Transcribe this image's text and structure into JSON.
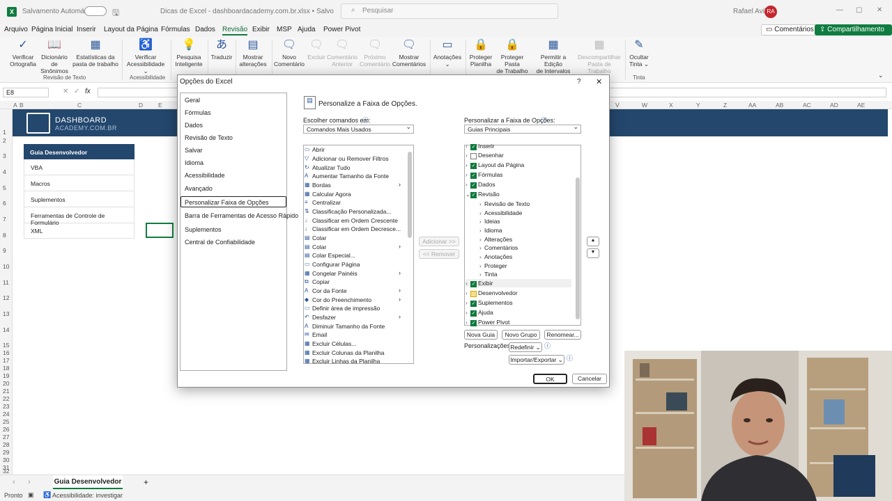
{
  "titlebar": {
    "autosave": "Salvamento Automático",
    "file_title": "Dicas de Excel - dashboardacademy.com.br.xlsx • Salvo",
    "search_placeholder": "Pesquisar",
    "user_name": "Rafael Avila",
    "user_initials": "RA"
  },
  "menu": {
    "tabs": [
      "Arquivo",
      "Página Inicial",
      "Inserir",
      "Layout da Página",
      "Fórmulas",
      "Dados",
      "Revisão",
      "Exibir",
      "MSP",
      "Ajuda",
      "Power Pivot"
    ],
    "active": "Revisão",
    "comments_btn": "Comentários",
    "share_btn": "Compartilhamento"
  },
  "ribbon": {
    "buttons": [
      {
        "l1": "Verificar",
        "l2": "Ortografia"
      },
      {
        "l1": "Dicionário de",
        "l2": "Sinônimos"
      },
      {
        "l1": "Estatísticas da",
        "l2": "pasta de trabalho"
      },
      {
        "l1": "Verificar",
        "l2": "Acessibilidade ⌄"
      },
      {
        "l1": "Pesquisa",
        "l2": "Inteligente"
      },
      {
        "l1": "Traduzir",
        "l2": ""
      },
      {
        "l1": "Mostrar",
        "l2": "alterações"
      },
      {
        "l1": "Novo",
        "l2": "Comentário"
      },
      {
        "l1": "Excluir",
        "l2": ""
      },
      {
        "l1": "Comentário",
        "l2": "Anterior"
      },
      {
        "l1": "Próximo",
        "l2": "Comentário"
      },
      {
        "l1": "Mostrar",
        "l2": "Comentários"
      },
      {
        "l1": "Anotações",
        "l2": "⌄"
      },
      {
        "l1": "Proteger",
        "l2": "Planilha"
      },
      {
        "l1": "Proteger Pasta",
        "l2": "de Trabalho"
      },
      {
        "l1": "Permitir a Edição",
        "l2": "de Intervalos"
      },
      {
        "l1": "Descompartilhar",
        "l2": "Pasta de Trabalho"
      },
      {
        "l1": "Ocultar",
        "l2": "Tinta ⌄"
      }
    ],
    "groups": [
      "Revisão de Texto",
      "Acessibilidade",
      "Tinta"
    ]
  },
  "formula": {
    "cell_ref": "E8",
    "fx": "fx"
  },
  "grid": {
    "columns": [
      "A",
      "B",
      "C",
      "D",
      "E",
      "V",
      "W",
      "X",
      "Y",
      "Z",
      "AA",
      "AB",
      "AC",
      "AD",
      "AE"
    ],
    "rows": [
      "1",
      "2",
      "3",
      "4",
      "5",
      "6",
      "7",
      "8",
      "9",
      "10",
      "11",
      "12",
      "13",
      "14",
      "15",
      "16",
      "17",
      "18",
      "19",
      "20",
      "21",
      "22",
      "23",
      "24",
      "25",
      "26",
      "27",
      "28",
      "29",
      "30",
      "31",
      "32"
    ],
    "brand_line1": "DASHBOARD",
    "brand_line2": "ACADEMY.COM.BR",
    "guide_title": "Guia Desenvolvedor",
    "guide_items": [
      "VBA",
      "Macros",
      "Suplementos",
      "Ferramentas de Controle de Formulário",
      "XML"
    ]
  },
  "sheet": {
    "tab": "Guia Desenvolvedor",
    "status_ready": "Pronto",
    "status_access": "Acessibilidade: investigar"
  },
  "dialog": {
    "title": "Opções do Excel",
    "help": "?",
    "close": "✕",
    "categories": [
      "Geral",
      "Fórmulas",
      "Dados",
      "Revisão de Texto",
      "Salvar",
      "Idioma",
      "Acessibilidade",
      "Avançado",
      "Personalizar Faixa de Opções",
      "Barra de Ferramentas de Acesso Rápido",
      "Suplementos",
      "Central de Confiabilidade"
    ],
    "heading": "Personalize a Faixa de Opções.",
    "choose_label": "Escolher comandos em:",
    "choose_value": "Comandos Mais Usados",
    "customize_label": "Personalizar a Faixa de Opções:",
    "customize_value": "Guias Principais",
    "commands": [
      "Abrir",
      "Adicionar ou Remover Filtros",
      "Atualizar Tudo",
      "Aumentar Tamanho da Fonte",
      "Bordas",
      "Calcular Agora",
      "Centralizar",
      "Classificação Personalizada...",
      "Classificar em Ordem Crescente",
      "Classificar em Ordem Decresce...",
      "Colar",
      "Colar",
      "Colar Especial...",
      "Configurar Página",
      "Congelar Painéis",
      "Copiar",
      "Cor da Fonte",
      "Cor do Preenchimento",
      "Definir área de impressão",
      "Desfazer",
      "Diminuir Tamanho da Fonte",
      "Email",
      "Excluir Células...",
      "Excluir Colunas da Planilha",
      "Excluir Linhas da Planilha"
    ],
    "add_btn": "Adicionar >>",
    "remove_btn": "<< Remover",
    "tree_top": [
      "Inserir",
      "Desenhar",
      "Layout da Página",
      "Fórmulas",
      "Dados",
      "Revisão"
    ],
    "tree_groups": [
      "Revisão de Texto",
      "Acessibilidade",
      "Ideias",
      "Idioma",
      "Alterações",
      "Comentários",
      "Anotações",
      "Proteger",
      "Tinta"
    ],
    "tree_bottom": [
      "Exibir",
      "Desenvolvedor",
      "Suplementos",
      "Ajuda",
      "Power Pivot"
    ],
    "new_tab": "Nova Guia",
    "new_group": "Novo Grupo",
    "rename": "Renomear...",
    "customizations": "Personalizações:",
    "reset": "Redefinir ⌄",
    "import_export": "Importar/Exportar ⌄",
    "ok": "OK",
    "cancel": "Cancelar"
  }
}
